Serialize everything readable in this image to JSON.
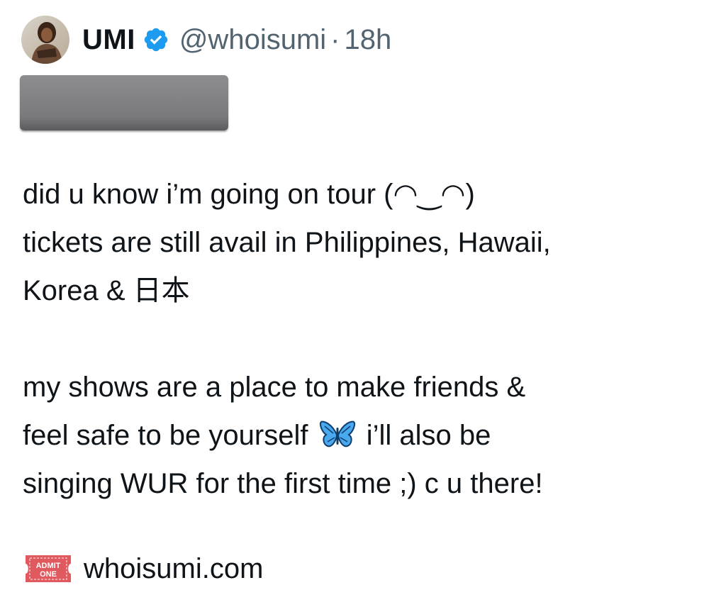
{
  "tweet": {
    "author": {
      "name": "UMI",
      "handle": "@whoisumi",
      "separator": "·",
      "time": "18h",
      "verified": true,
      "avatar_icon": "profile-photo",
      "verified_icon": "verified-badge-icon"
    },
    "redacted_block": {
      "color": "#7b7b7d"
    },
    "body": {
      "line1": "did u know i’m going on tour (◠‿◠)",
      "line2": "tickets are still avail in Philippines, Hawaii,",
      "line3": "Korea & 日本",
      "line4": "my shows are a place to make friends &",
      "line5a": "feel safe to be yourself",
      "line5b": "i’ll also be",
      "line6": "singing WUR for the first time ;) c u there!"
    },
    "link": {
      "ticket_icon": "admit-one-ticket-icon",
      "ticket_text_top": "ADMIT",
      "ticket_text_bottom": "ONE",
      "url": "whoisumi.com"
    },
    "colors": {
      "text": "#0f1419",
      "secondary": "#536471",
      "verified_blue": "#1d9bf0",
      "ticket_red": "#e0595e"
    }
  }
}
